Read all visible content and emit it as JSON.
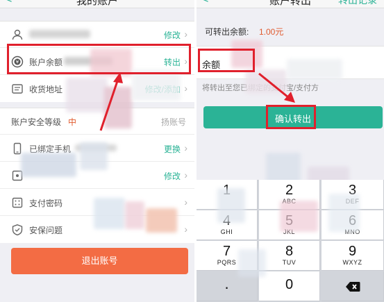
{
  "left": {
    "back_glyph": "<",
    "title": "我的账户",
    "rows": [
      {
        "label": "",
        "action": "修改"
      },
      {
        "label": "账户余额",
        "action": "转出"
      },
      {
        "label": "收货地址",
        "action": "修改/添加"
      },
      {
        "label": "账户安全等级",
        "level": "中",
        "right": "扬账号"
      },
      {
        "label": "已绑定手机",
        "action": "更换"
      },
      {
        "label": "",
        "action": "修改"
      },
      {
        "label": "支付密码",
        "action": ""
      },
      {
        "label": "安保问题",
        "action": ""
      }
    ],
    "logout_label": "退出账号"
  },
  "right": {
    "back_glyph": "<",
    "title": "账户转出",
    "right_link": "转出记录",
    "available_label": "可转出余额:",
    "available_amount": "1.00元",
    "balance_label": "余额",
    "note": "将转出至您已绑定的支付宝/支付方",
    "confirm_label": "确认转出",
    "keys": [
      {
        "num": "1",
        "letters": ""
      },
      {
        "num": "2",
        "letters": "ABC"
      },
      {
        "num": "3",
        "letters": "DEF"
      },
      {
        "num": "4",
        "letters": "GHI"
      },
      {
        "num": "5",
        "letters": "JKL"
      },
      {
        "num": "6",
        "letters": "MNO"
      },
      {
        "num": "7",
        "letters": "PQRS"
      },
      {
        "num": "8",
        "letters": "TUV"
      },
      {
        "num": "9",
        "letters": "WXYZ"
      },
      {
        "num": ".",
        "letters": ""
      },
      {
        "num": "0",
        "letters": ""
      },
      {
        "num": "⌫",
        "letters": ""
      }
    ]
  },
  "colors": {
    "accent": "#2bb396",
    "logout": "#f36c44",
    "highlight": "#e0202c",
    "amount": "#e05a2e"
  }
}
